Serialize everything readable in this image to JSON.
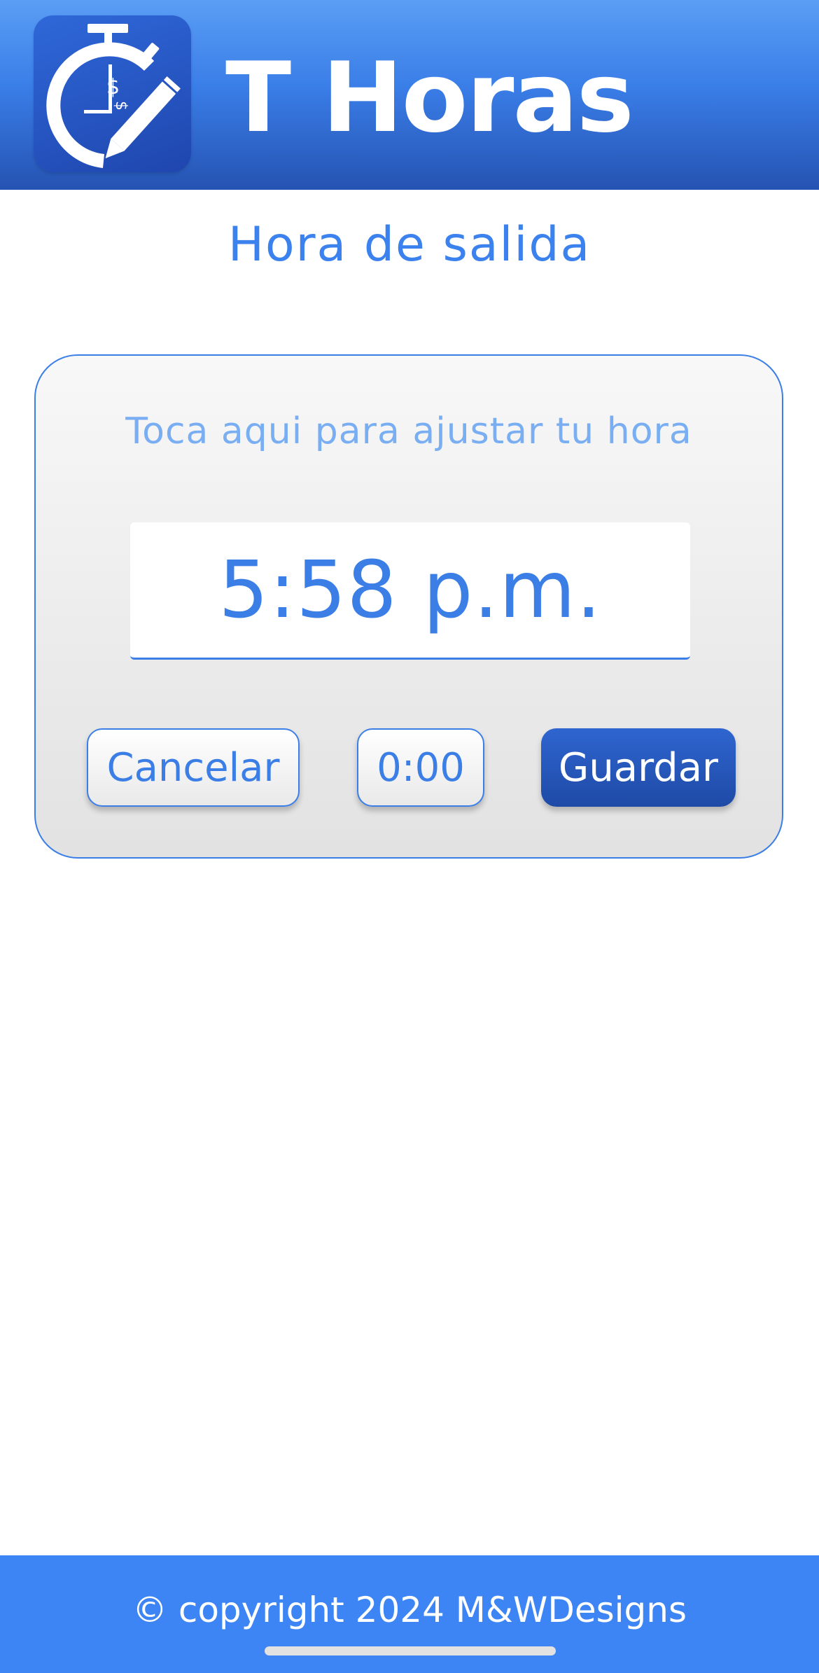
{
  "header": {
    "app_name": "T Horas",
    "logo_icon": "stopwatch-dollar-pencil-icon"
  },
  "page": {
    "title": "Hora de salida"
  },
  "time_card": {
    "hint": "Toca aqui para ajustar tu hora",
    "time_value": "5:58 p.m."
  },
  "buttons": {
    "cancel_label": "Cancelar",
    "reset_label": "0:00",
    "save_label": "Guardar"
  },
  "footer": {
    "copyright": "© copyright 2024 M&WDesigns"
  },
  "colors": {
    "primary": "#3b82ee",
    "header_dark": "#2553b2",
    "footer": "#3d84f5",
    "save_button": "#1e4aa6"
  }
}
